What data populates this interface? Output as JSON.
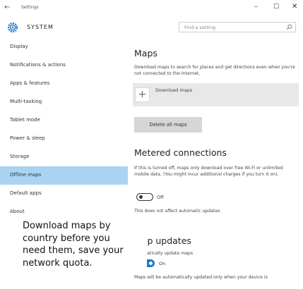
{
  "window": {
    "title": "Settings",
    "back_glyph": "←",
    "minimize_glyph": "–",
    "maximize_glyph": "☐",
    "close_glyph": "✕"
  },
  "header": {
    "section_title": "SYSTEM",
    "section_icon": "gear-icon",
    "search_placeholder": "Find a setting",
    "search_icon": "search-icon"
  },
  "sidebar": {
    "items": [
      {
        "label": "Display"
      },
      {
        "label": "Notifications & actions"
      },
      {
        "label": "Apps & features"
      },
      {
        "label": "Multi-tasking"
      },
      {
        "label": "Tablet mode"
      },
      {
        "label": "Power & sleep"
      },
      {
        "label": "Storage"
      },
      {
        "label": "Offline maps",
        "active": true
      },
      {
        "label": "Default apps"
      },
      {
        "label": "About"
      }
    ]
  },
  "maps": {
    "title": "Maps",
    "description": "Download maps to search for places and get directions even when you're not connected to the Internet.",
    "download_label": "Download maps",
    "plus_glyph": "+",
    "delete_label": "Delete all maps"
  },
  "metered": {
    "title": "Metered connections",
    "description": "If this is turned off, maps only download over free Wi-Fi or unlimited mobile data. (You might incur additional charges if you turn it on).",
    "toggle_state": "Off",
    "note": "This does not affect automatic updates."
  },
  "updates": {
    "title": "Map updates",
    "toggle_caption": "...tomatically update maps",
    "toggle_state": "On",
    "description": "Maps will be automatically updated only when your device is"
  },
  "caption": {
    "lines": [
      "Download maps by",
      "country before you",
      "need them, save your",
      "network quota."
    ]
  },
  "colors": {
    "active_nav": "#aad3f2",
    "toggle_on": "#1e76d0",
    "download_row": "#e8e8e8"
  }
}
